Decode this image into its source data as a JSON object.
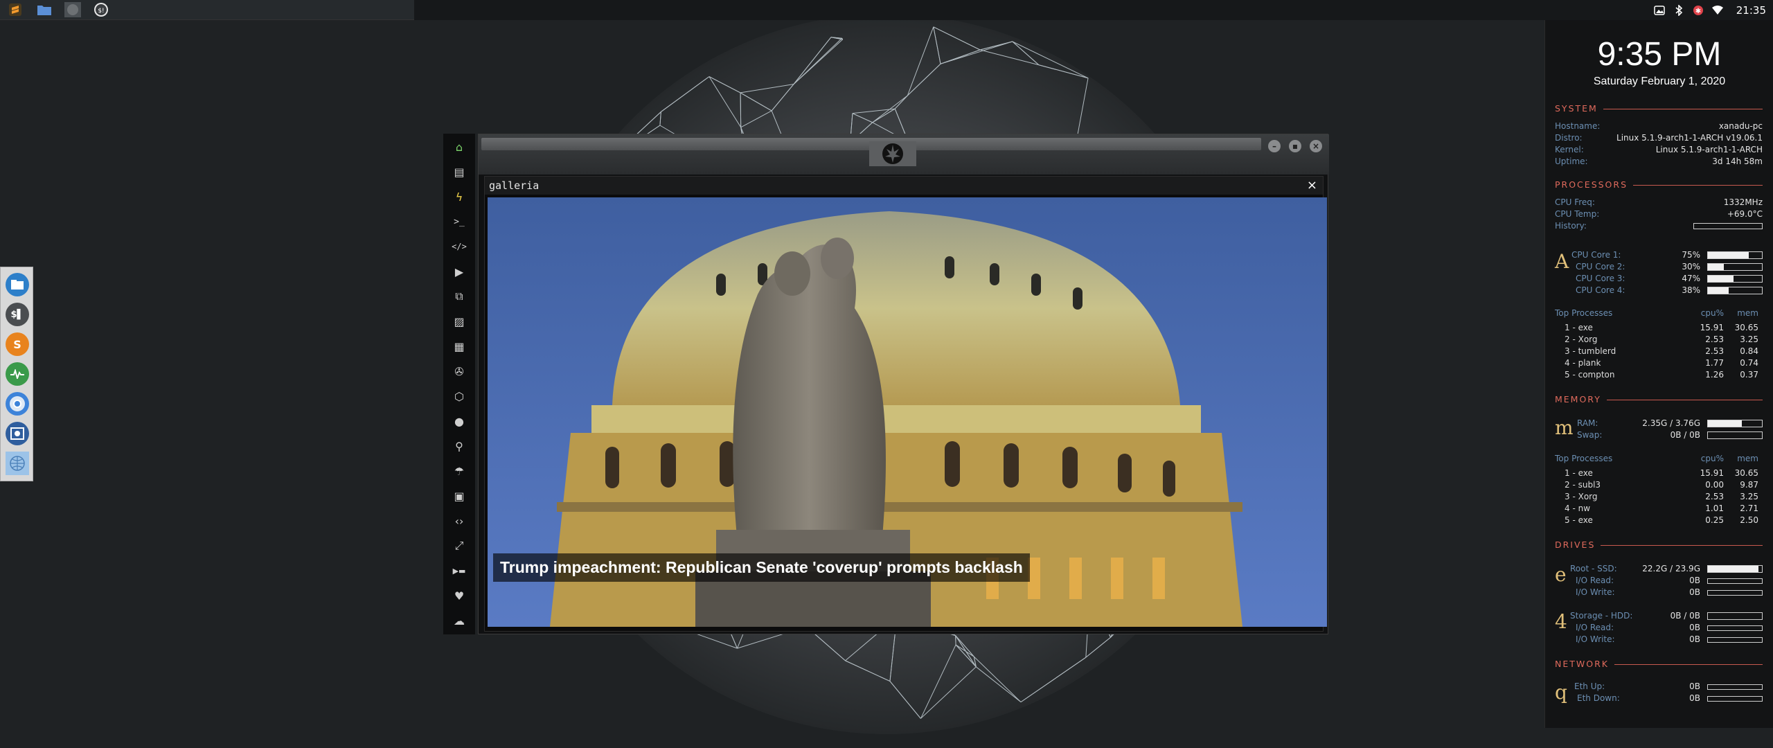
{
  "top_bar": {
    "launchers": [
      "sublime-text-icon",
      "file-manager-icon",
      "workspace-icon",
      "terminal-icon"
    ],
    "tray_icons": [
      "image-icon",
      "bluetooth-icon",
      "settings-alert-icon",
      "wifi-icon"
    ],
    "time": "21:35"
  },
  "dock": {
    "items": [
      "files-icon",
      "terminal-icon",
      "sublime-text-icon",
      "system-monitor-icon",
      "chrome-icon",
      "screenshot-icon",
      "network-icon"
    ]
  },
  "app_sidebar": {
    "items": [
      "home-icon",
      "document-icon",
      "lightning-icon",
      "terminal-icon",
      "code-icon",
      "play-icon",
      "translate-icon",
      "image-icon",
      "news-icon",
      "aperture-icon",
      "hexagon-icon",
      "globe-icon",
      "search-icon",
      "umbrella-icon",
      "contact-icon",
      "code-brackets-icon",
      "expand-icon",
      "youtube-icon",
      "heart-icon",
      "cloud-icon"
    ]
  },
  "window": {
    "panel_title": "galleria",
    "close_glyph": "×",
    "caption": "Trump impeachment: Republican Senate 'coverup' prompts backlash"
  },
  "conky": {
    "clock": "9:35 PM",
    "date": "Saturday February  1, 2020",
    "system": {
      "header": "SYSTEM",
      "rows": [
        {
          "k": "Hostname:",
          "v": "xanadu-pc"
        },
        {
          "k": "Distro:",
          "v": "Linux 5.1.9-arch1-1-ARCH v19.06.1"
        },
        {
          "k": "Kernel:",
          "v": "Linux 5.1.9-arch1-1-ARCH"
        },
        {
          "k": "Uptime:",
          "v": "3d 14h 58m"
        }
      ]
    },
    "processors": {
      "header": "PROCESSORS",
      "freq_label": "CPU Freq:",
      "freq": "1332MHz",
      "temp_label": "CPU Temp:",
      "temp": "+69.0°C",
      "history_label": "History:",
      "glyph": "A",
      "cores": [
        {
          "label": "CPU Core 1:",
          "value": "75%",
          "level": 0.75
        },
        {
          "label": "CPU Core 2:",
          "value": "30%",
          "level": 0.3
        },
        {
          "label": "CPU Core 3:",
          "value": "47%",
          "level": 0.47
        },
        {
          "label": "CPU Core 4:",
          "value": "38%",
          "level": 0.38
        }
      ],
      "top_label": "Top Processes",
      "col_cpu": "cpu%",
      "col_mem": "mem",
      "procs": [
        {
          "name": "1  -  exe",
          "cpu": "15.91",
          "mem": "30.65"
        },
        {
          "name": "2  -  Xorg",
          "cpu": "2.53",
          "mem": "3.25"
        },
        {
          "name": "3  -  tumblerd",
          "cpu": "2.53",
          "mem": "0.84"
        },
        {
          "name": "4  -  plank",
          "cpu": "1.77",
          "mem": "0.74"
        },
        {
          "name": "5  -  compton",
          "cpu": "1.26",
          "mem": "0.37"
        }
      ]
    },
    "memory": {
      "header": "MEMORY",
      "glyph": "m",
      "ram_label": "RAM:",
      "ram": "2.35G / 3.76G",
      "ram_level": 0.63,
      "swap_label": "Swap:",
      "swap": "0B / 0B",
      "swap_level": 0,
      "top_label": "Top Processes",
      "col_cpu": "cpu%",
      "col_mem": "mem",
      "procs": [
        {
          "name": "1  -  exe",
          "cpu": "15.91",
          "mem": "30.65"
        },
        {
          "name": "2  -  subl3",
          "cpu": "0.00",
          "mem": "9.87"
        },
        {
          "name": "3  -  Xorg",
          "cpu": "2.53",
          "mem": "3.25"
        },
        {
          "name": "4  -  nw",
          "cpu": "1.01",
          "mem": "2.71"
        },
        {
          "name": "5  -  exe",
          "cpu": "0.25",
          "mem": "2.50"
        }
      ]
    },
    "drives": {
      "header": "DRIVES",
      "root_glyph": "e",
      "root_label": "Root  -  SSD:",
      "root": "22.2G / 23.9G",
      "root_level": 0.93,
      "root_read_label": "I/O Read:",
      "root_read": "0B",
      "root_write_label": "I/O Write:",
      "root_write": "0B",
      "storage_glyph": "4",
      "storage_label": "Storage  -  HDD:",
      "storage": "0B / 0B",
      "storage_level": 0,
      "storage_read_label": "I/O Read:",
      "storage_read": "0B",
      "storage_write_label": "I/O Write:",
      "storage_write": "0B"
    },
    "network": {
      "header": "NETWORK",
      "glyph": "q",
      "up_label": "Eth Up:",
      "up": "0B",
      "down_label": "Eth Down:",
      "down": "0B"
    }
  }
}
